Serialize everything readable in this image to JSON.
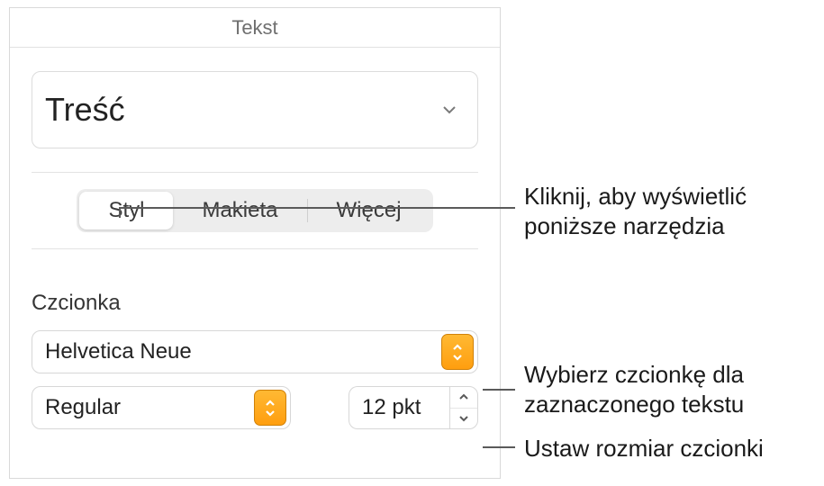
{
  "panel": {
    "title": "Tekst"
  },
  "paragraph_style": {
    "value": "Treść"
  },
  "tabs": {
    "style": "Styl",
    "layout": "Makieta",
    "more": "Więcej"
  },
  "font_section": {
    "title": "Czcionka",
    "family": "Helvetica Neue",
    "weight": "Regular",
    "size": "12 pkt"
  },
  "annotations": {
    "tabs": "Kliknij, aby wyświetlić poniższe narzędzia",
    "family": "Wybierz czcionkę dla zaznaczonego tekstu",
    "size": "Ustaw rozmiar czcionki"
  }
}
